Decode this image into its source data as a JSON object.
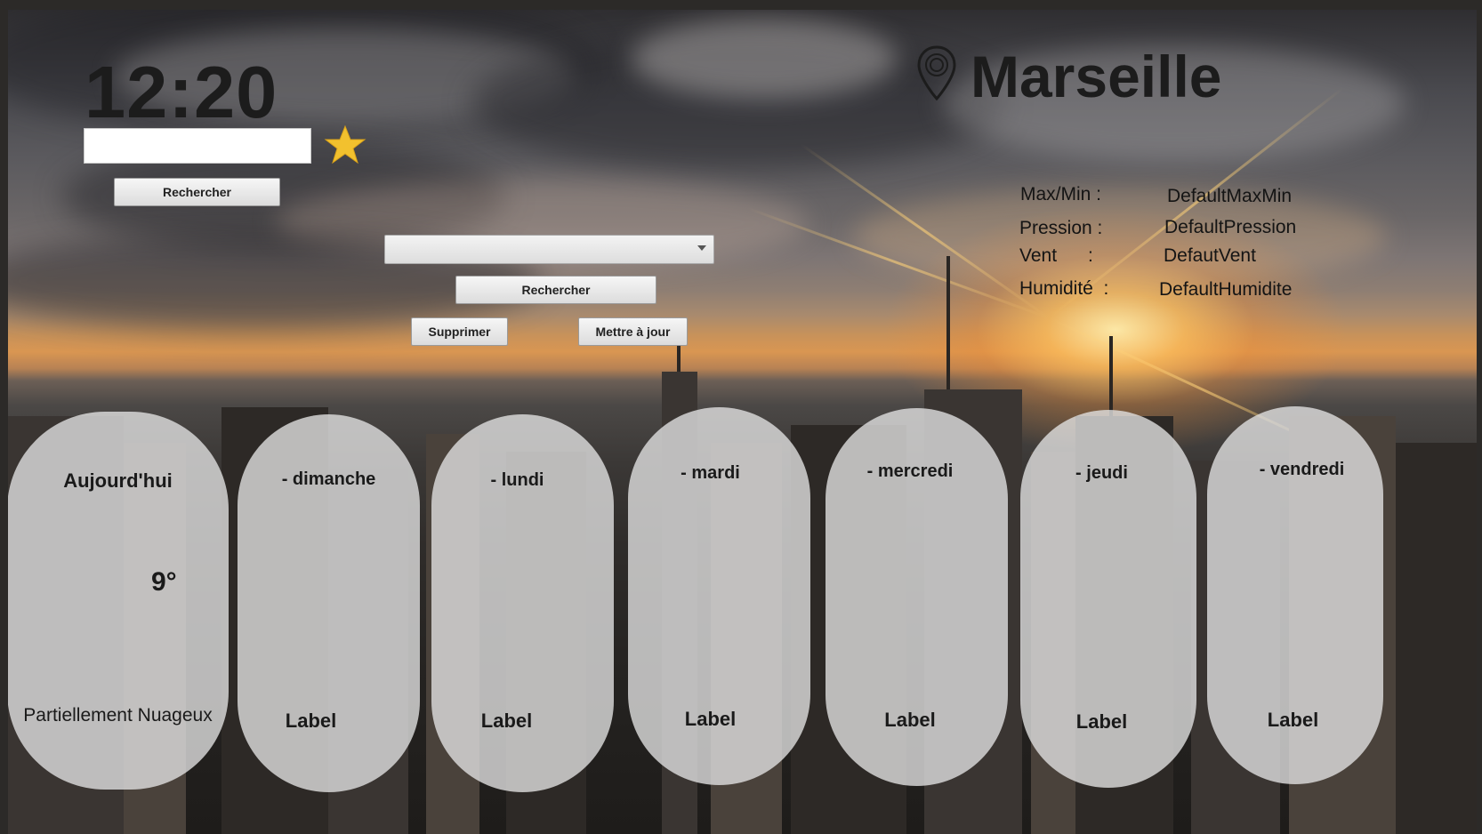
{
  "clock": {
    "time": "12:20"
  },
  "search": {
    "value": "",
    "favorite_icon": "star-icon",
    "button_label": "Rechercher"
  },
  "favorites": {
    "selected": "",
    "search_label": "Rechercher",
    "delete_label": "Supprimer",
    "update_label": "Mettre à jour"
  },
  "location": {
    "icon": "location-pin-icon",
    "city": "Marseille"
  },
  "details": [
    {
      "label": "Max/Min :",
      "value": "DefaultMaxMin"
    },
    {
      "label": "Pression :",
      "value": "DefaultPression"
    },
    {
      "label": "Vent      :",
      "value": "DefautVent"
    },
    {
      "label": "Humidité  :",
      "value": "DefaultHumidite"
    }
  ],
  "forecast": [
    {
      "title": "Aujourd'hui",
      "temp": "9°",
      "desc": "Partiellement Nuageux"
    },
    {
      "title": "- dimanche",
      "desc": "Label"
    },
    {
      "title": "- lundi",
      "desc": "Label"
    },
    {
      "title": "- mardi",
      "desc": "Label"
    },
    {
      "title": "- mercredi",
      "desc": "Label"
    },
    {
      "title": "- jeudi",
      "desc": "Label"
    },
    {
      "title": "- vendredi",
      "desc": "Label"
    }
  ],
  "colors": {
    "accent_star": "#f2c12e",
    "text": "#1c1c1c",
    "card": "#e4e4e4"
  }
}
